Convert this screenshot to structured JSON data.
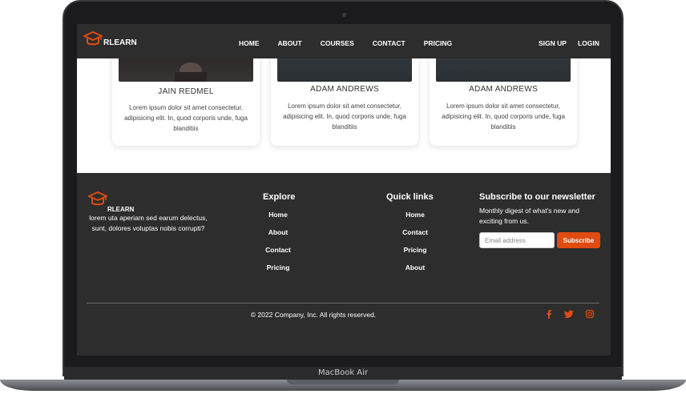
{
  "device": {
    "model_label": "MacBook Air"
  },
  "colors": {
    "accent": "#e04b10",
    "dark": "#2d2d2d"
  },
  "nav": {
    "brand": "RLEARN",
    "brand_icon": "graduation-cap-icon",
    "links": [
      "HOME",
      "ABOUT",
      "COURSES",
      "CONTACT",
      "PRICING"
    ],
    "sign_up": "SIGN UP",
    "login": "LOGIN"
  },
  "team": {
    "cards": [
      {
        "name": "JAIN REDMEL",
        "text": "Lorem ipsum dolor sit amet consectetur, adipisicing elit. In, quod corporis unde, fuga blanditiis"
      },
      {
        "name": "ADAM ANDREWS",
        "text": "Lorem ipsum dolor sit amet consectetur, adipisicing elit. In, quod corporis unde, fuga blanditiis"
      },
      {
        "name": "ADAM ANDREWS",
        "text": "Lorem ipsum dolor sit amet consectetur, adipisicing elit. In, quod corporis unde, fuga blanditiis"
      }
    ]
  },
  "footer": {
    "brand": "RLEARN",
    "description": "lorem uta aperiam sed earum delectus, sunt, dolores voluptas nobis corrupti?",
    "explore": {
      "title": "Explore",
      "links": [
        "Home",
        "About",
        "Contact",
        "Pricing"
      ]
    },
    "quick_links": {
      "title": "Quick links",
      "links": [
        "Home",
        "Contact",
        "Pricing",
        "About"
      ]
    },
    "newsletter": {
      "title": "Subscribe to our newsletter",
      "description": "Monthly digest of what's new and exciting from us.",
      "email_placeholder": "Email address",
      "subscribe_label": "Subscribe"
    },
    "copyright": "© 2022 Company, Inc. All rights reserved.",
    "social_icons": [
      "facebook-icon",
      "twitter-icon",
      "instagram-icon"
    ]
  }
}
